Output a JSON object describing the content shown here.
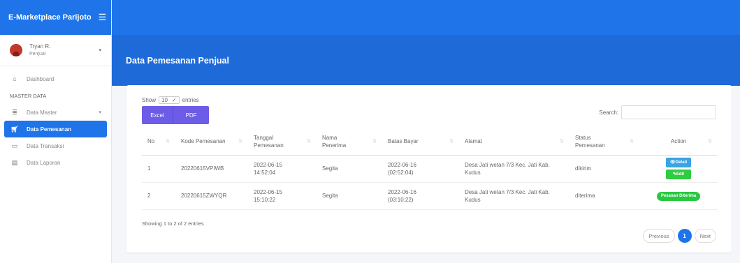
{
  "app": {
    "title": "E-Marketplace Parijoto",
    "menu_icon": "hamburger-icon"
  },
  "user": {
    "name": "Tryan R.",
    "role": "Penjual"
  },
  "sidebar": {
    "dashboard": "Dashboard",
    "section": "MASTER DATA",
    "items": [
      {
        "label": "Data Master",
        "icon": "database-icon"
      },
      {
        "label": "Data Pemesanan",
        "icon": "cart-icon"
      },
      {
        "label": "Data Transaksi",
        "icon": "money-icon"
      },
      {
        "label": "Data Laporan",
        "icon": "report-icon"
      }
    ]
  },
  "page": {
    "title": "Data Pemesanan Penjual"
  },
  "table_controls": {
    "show": "Show",
    "length_value": "10",
    "entries": "entries",
    "excel": "Excel",
    "pdf": "PDF",
    "search_label": "Search:"
  },
  "table": {
    "headers": [
      "No",
      "Kode Pemesanan",
      "Tanggal\nPemesanan",
      "Nama\nPenerima",
      "Batas Bayar",
      "Alamat",
      "Status\nPemesanan",
      "Action"
    ],
    "rows": [
      {
        "no": "1",
        "kode": "20220615VPIWB",
        "tanggal": "2022-06-15\n14:52:04",
        "nama": "Segita",
        "batas": "2022-06-16\n(02:52:04)",
        "alamat": "Desa Jati wetan 7/3 Kec. Jati Kab.\nKudus",
        "status": "dikirim",
        "detail": "Detail",
        "edit": "Edit"
      },
      {
        "no": "2",
        "kode": "20220615ZWYQR",
        "tanggal": "2022-06-15\n15:10:22",
        "nama": "Segita",
        "batas": "2022-06-16\n(03:10:22)",
        "alamat": "Desa Jati wetan 7/3 Kec. Jati Kab.\nKudus",
        "status": "diterima",
        "badge": "Pesanan Diterima"
      }
    ]
  },
  "footer": {
    "info": "Showing 1 to 2 of 2 entries",
    "previous": "Previous",
    "page": "1",
    "next": "Next"
  },
  "colors": {
    "primary": "#1e74e8",
    "header": "#1e6ad9",
    "export_buttons": "#6c5ce7",
    "detail": "#3aa3e3",
    "success": "#2ecc40"
  }
}
